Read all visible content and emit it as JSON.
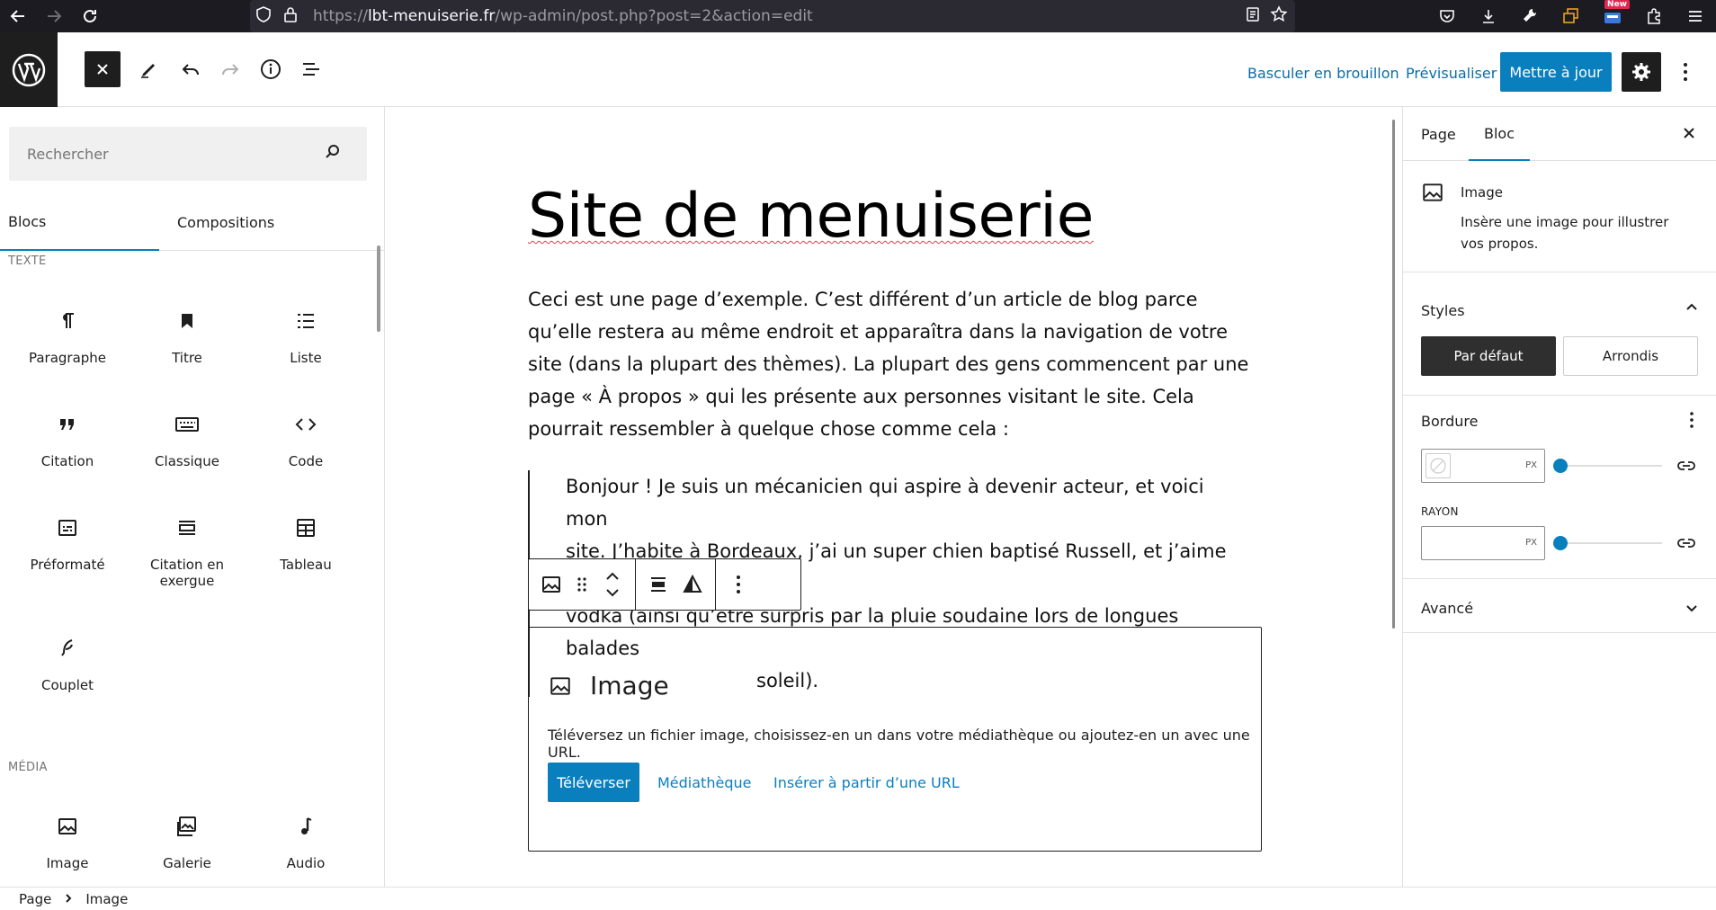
{
  "browser": {
    "url_prefix": "https://",
    "url_host": "lbt-menuiserie.fr",
    "url_path": "/wp-admin/post.php?post=2&action=edit",
    "badge_new": "New"
  },
  "toolbar": {
    "switch_draft": "Basculer en brouillon",
    "preview": "Prévisualiser",
    "update": "Mettre à jour"
  },
  "inserter": {
    "search_placeholder": "Rechercher",
    "tabs": [
      "Blocs",
      "Compositions"
    ],
    "categories": {
      "text": "TEXTE",
      "media": "MÉDIA"
    },
    "text_blocks": [
      {
        "label": "Paragraphe",
        "icon": "paragraph-icon"
      },
      {
        "label": "Titre",
        "icon": "bookmark-icon"
      },
      {
        "label": "Liste",
        "icon": "list-icon"
      },
      {
        "label": "Citation",
        "icon": "quote-icon"
      },
      {
        "label": "Classique",
        "icon": "keyboard-icon"
      },
      {
        "label": "Code",
        "icon": "code-icon"
      },
      {
        "label": "Préformaté",
        "icon": "preformatted-icon"
      },
      {
        "label": "Citation en exergue",
        "icon": "pullquote-icon"
      },
      {
        "label": "Tableau",
        "icon": "table-icon"
      },
      {
        "label": "Couplet",
        "icon": "verse-icon"
      }
    ],
    "media_blocks": [
      {
        "label": "Image",
        "icon": "image-icon"
      },
      {
        "label": "Galerie",
        "icon": "gallery-icon"
      },
      {
        "label": "Audio",
        "icon": "audio-icon"
      }
    ]
  },
  "editor": {
    "title": "Site de menuiserie",
    "paragraph": "Ceci est une page d’exemple. C’est différent d’un article de blog parce qu’elle restera au même endroit et apparaîtra dans la navigation de votre site (dans la plupart des thèmes). La plupart des gens commencent par une page « À propos » qui les présente aux personnes visitant le site. Cela pourrait ressembler à quelque chose comme cela :",
    "quote_line1": "Bonjour ! Je suis un mécanicien qui aspire à devenir acteur, et voici mon",
    "quote_line2": "site. J’habite à Bordeaux, j’ai un super chien baptisé Russell, et j’aime la",
    "quote_line3": "vodka (ainsi qu’être surpris par la pluie soudaine lors de longues balades",
    "quote_line4_end": "soleil).",
    "image_block": {
      "title": "Image",
      "instructions": "Téléversez un fichier image, choisissez-en un dans votre médiathèque ou ajoutez-en un avec une URL.",
      "upload": "Téléverser",
      "library": "Médiathèque",
      "insert_url": "Insérer à partir d’une URL"
    }
  },
  "sidebar": {
    "tabs": [
      "Page",
      "Bloc"
    ],
    "block_name": "Image",
    "block_desc": "Insère une image pour illustrer vos propos.",
    "styles_title": "Styles",
    "style_default": "Par défaut",
    "style_rounded": "Arrondis",
    "border_title": "Bordure",
    "unit": "PX",
    "radius_label": "RAYON",
    "advanced_title": "Avancé"
  },
  "footer": {
    "crumbs": [
      "Page",
      "Image"
    ]
  }
}
